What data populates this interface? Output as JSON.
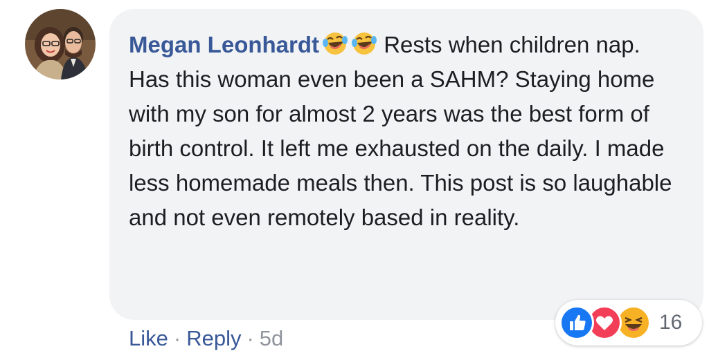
{
  "comment": {
    "author": "Megan Leonhardt",
    "text": "Rests when children nap. Has this woman even been a SAHM? Staying home with my son for almost 2 years was the best form of birth control. It left me exhausted on the daily. I made less homemade meals then. This post is so laughable and not even remotely based in reality.",
    "emojis": [
      "laughing-with-tears-emoji",
      "laughing-with-tears-emoji"
    ]
  },
  "actions": {
    "like_label": "Like",
    "separator": "·",
    "reply_label": "Reply",
    "time": "5d"
  },
  "reactions": {
    "icons": [
      "like-reaction-icon",
      "love-reaction-icon",
      "haha-reaction-icon"
    ],
    "count": "16"
  },
  "colors": {
    "author": "#385898",
    "bubble": "#f2f3f5",
    "text": "#1c1e21",
    "like": "#1877f2",
    "love": "#f33e58",
    "haha": "#f7b125"
  }
}
